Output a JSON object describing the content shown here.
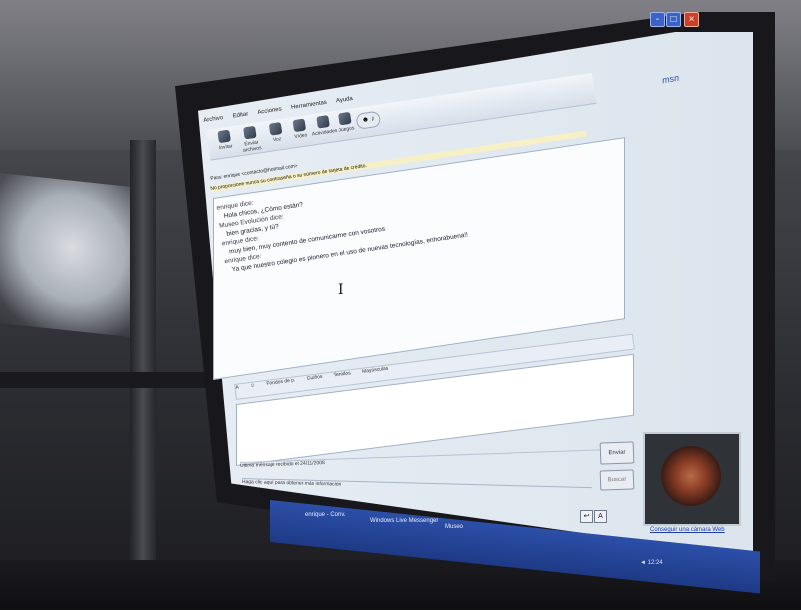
{
  "window": {
    "minimize_label": "-",
    "maximize_label": "□",
    "close_label": "×",
    "brand": "msn"
  },
  "menubar": [
    "Archivo",
    "Editar",
    "Acciones",
    "Herramientas",
    "Ayuda"
  ],
  "toolbar": {
    "tools": [
      "Invitar",
      "Enviar archivos",
      "Voz",
      "Vídeo",
      "Actividades",
      "Juegos"
    ],
    "emote_label": "☻ ♪"
  },
  "conversation": {
    "to_line": "Para: enrique <contacto@hotmail.com>",
    "warning_line": "No proporcione nunca su contraseña o su número de tarjeta de crédito.",
    "messages": [
      {
        "who": "enrique dice:",
        "text": "Hola chicos, ¿Cómo están?"
      },
      {
        "who": "Museo Evolución dice:",
        "text": "bien gracias, y tú?"
      },
      {
        "who": "enrique dice:",
        "text": "muy bien, muy contento de comunicarme con vosotros"
      },
      {
        "who": "enrique dice:",
        "text": "Ya que nuestro colegio es pionero en el uso de nuevas tecnologías, enhorabuena!!"
      }
    ]
  },
  "cursor_glyph": "I",
  "format_bar": [
    "A",
    "☺",
    "Fondos de p.",
    "Guiños",
    "Tenidos",
    "Mayúsculas"
  ],
  "send_label": "Enviar",
  "search_label": "Buscar",
  "status_line": "Último mensaje recibido el 24/11/2008",
  "bottom_bar": "Haga clic aquí para obtener más información",
  "format_buttons": [
    "↩",
    "A"
  ],
  "webcam_link": "Conseguir una cámara Web",
  "taskbar": {
    "items": [
      "enrique - Conv.",
      "Windows Live Messenger",
      "Museo"
    ],
    "tray": "◄ 12:24"
  }
}
